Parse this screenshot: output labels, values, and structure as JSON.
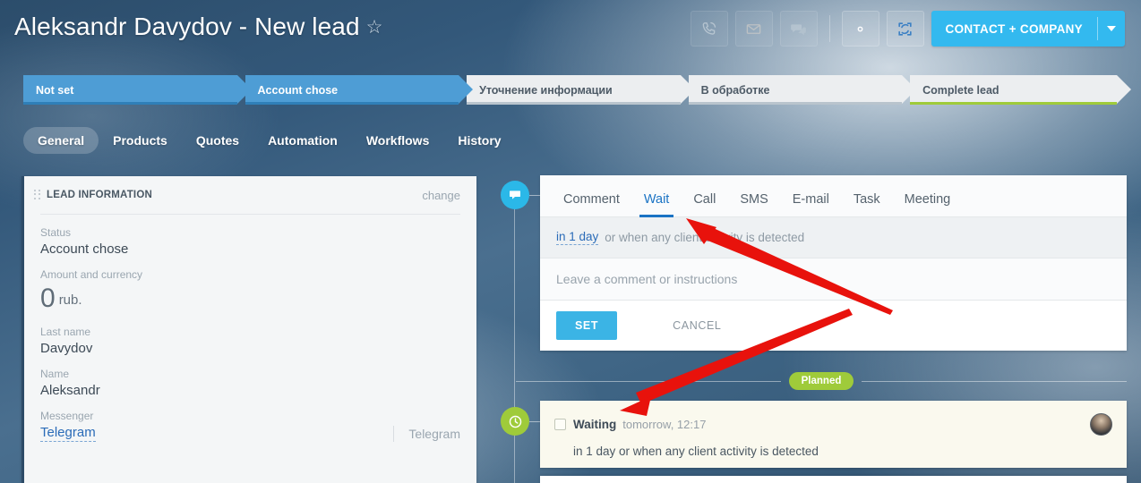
{
  "header": {
    "title": "Aleksandr Davydov - New lead",
    "star_icon": "star-outline-icon",
    "actions": [
      {
        "name": "call-button",
        "icon": "phone-icon"
      },
      {
        "name": "email-button",
        "icon": "envelope-icon"
      },
      {
        "name": "chat-button",
        "icon": "chat-bubbles-icon"
      }
    ],
    "settings_icon": "gear-icon",
    "sync_icon": "sync-arrows-icon",
    "contact_button": {
      "label": "CONTACT + COMPANY",
      "caret_icon": "chevron-down-icon"
    }
  },
  "stages": [
    {
      "label": "Not set",
      "state": "active"
    },
    {
      "label": "Account chose",
      "state": "active"
    },
    {
      "label": "Уточнение информации",
      "state": "idle"
    },
    {
      "label": "В обработке",
      "state": "idle"
    },
    {
      "label": "Complete lead",
      "state": "idle-green"
    }
  ],
  "tabs": [
    {
      "label": "General",
      "active": true
    },
    {
      "label": "Products",
      "active": false
    },
    {
      "label": "Quotes",
      "active": false
    },
    {
      "label": "Automation",
      "active": false
    },
    {
      "label": "Workflows",
      "active": false
    },
    {
      "label": "History",
      "active": false
    }
  ],
  "lead_panel": {
    "title": "LEAD INFORMATION",
    "change_label": "change",
    "fields": [
      {
        "label": "Status",
        "value": "Account chose"
      },
      {
        "label": "Amount and currency",
        "amount": "0",
        "currency": "rub."
      },
      {
        "label": "Last name",
        "value": "Davydov"
      },
      {
        "label": "Name",
        "value": "Aleksandr"
      },
      {
        "label": "Messenger",
        "value": "Telegram",
        "right_value": "Telegram"
      }
    ]
  },
  "composer": {
    "timeline_icon": "chat-bubble-icon",
    "tabs": [
      {
        "label": "Comment",
        "active": false
      },
      {
        "label": "Wait",
        "active": true
      },
      {
        "label": "Call",
        "active": false
      },
      {
        "label": "SMS",
        "active": false
      },
      {
        "label": "E-mail",
        "active": false
      },
      {
        "label": "Task",
        "active": false
      },
      {
        "label": "Meeting",
        "active": false
      }
    ],
    "when_link": "in 1 day",
    "when_rest": "or when any client activity is detected",
    "input_placeholder": "Leave a comment or instructions",
    "set_label": "SET",
    "cancel_label": "CANCEL"
  },
  "timeline": {
    "planned_badge": "Planned",
    "waiting_card": {
      "timeline_icon": "clock-icon",
      "checkbox_name": "waiting-checkbox",
      "title": "Waiting",
      "time": "tomorrow, 12:17",
      "description": "in 1 day or when any client activity is detected",
      "avatar_name": "user-avatar"
    }
  },
  "colors": {
    "accent_blue": "#33b9ef",
    "stage_active": "#4e9dd5",
    "stage_idle": "#eceef0",
    "green": "#9fcb3a",
    "tab_active_blue": "#1a73c4",
    "annotation_red": "#e8120c"
  }
}
